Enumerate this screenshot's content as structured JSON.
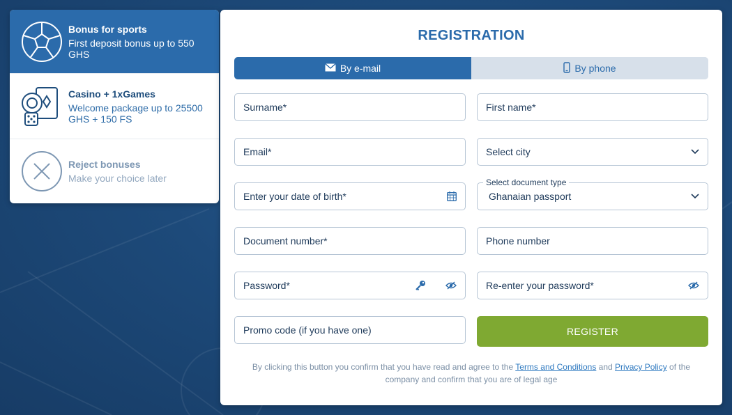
{
  "bonuses": [
    {
      "icon": "soccer-ball-icon",
      "title": "Bonus for sports",
      "desc": "First deposit bonus up to 550 GHS"
    },
    {
      "icon": "casino-chips-cards-icon",
      "title": "Casino + 1xGames",
      "desc": "Welcome package up to 25500 GHS + 150 FS"
    },
    {
      "icon": "reject-x-icon",
      "title": "Reject bonuses",
      "desc": "Make your choice later"
    }
  ],
  "registration": {
    "title": "REGISTRATION",
    "tabs": [
      {
        "label": "By e-mail",
        "icon": "envelope-icon",
        "active": true
      },
      {
        "label": "By phone",
        "icon": "phone-icon",
        "active": false
      }
    ],
    "fields": {
      "surname": "Surname*",
      "first_name": "First name*",
      "email": "Email*",
      "city": "Select city",
      "dob": "Enter your date of birth*",
      "doc_type_label": "Select document type",
      "doc_type_value": "Ghanaian passport",
      "doc_number": "Document number*",
      "phone": "Phone number",
      "password": "Password*",
      "repassword": "Re-enter your password*",
      "promo": "Promo code (if you have one)"
    },
    "register_label": "REGISTER",
    "terms": {
      "before": "By clicking this button you confirm that you have read and agree to the ",
      "link1": "Terms and Conditions",
      "mid": " and ",
      "link2": "Privacy Policy",
      "after": " of the company and confirm that you are of legal age"
    }
  },
  "colors": {
    "primary": "#2b6bab",
    "register": "#7fa932",
    "background": "#1d4a7a"
  }
}
